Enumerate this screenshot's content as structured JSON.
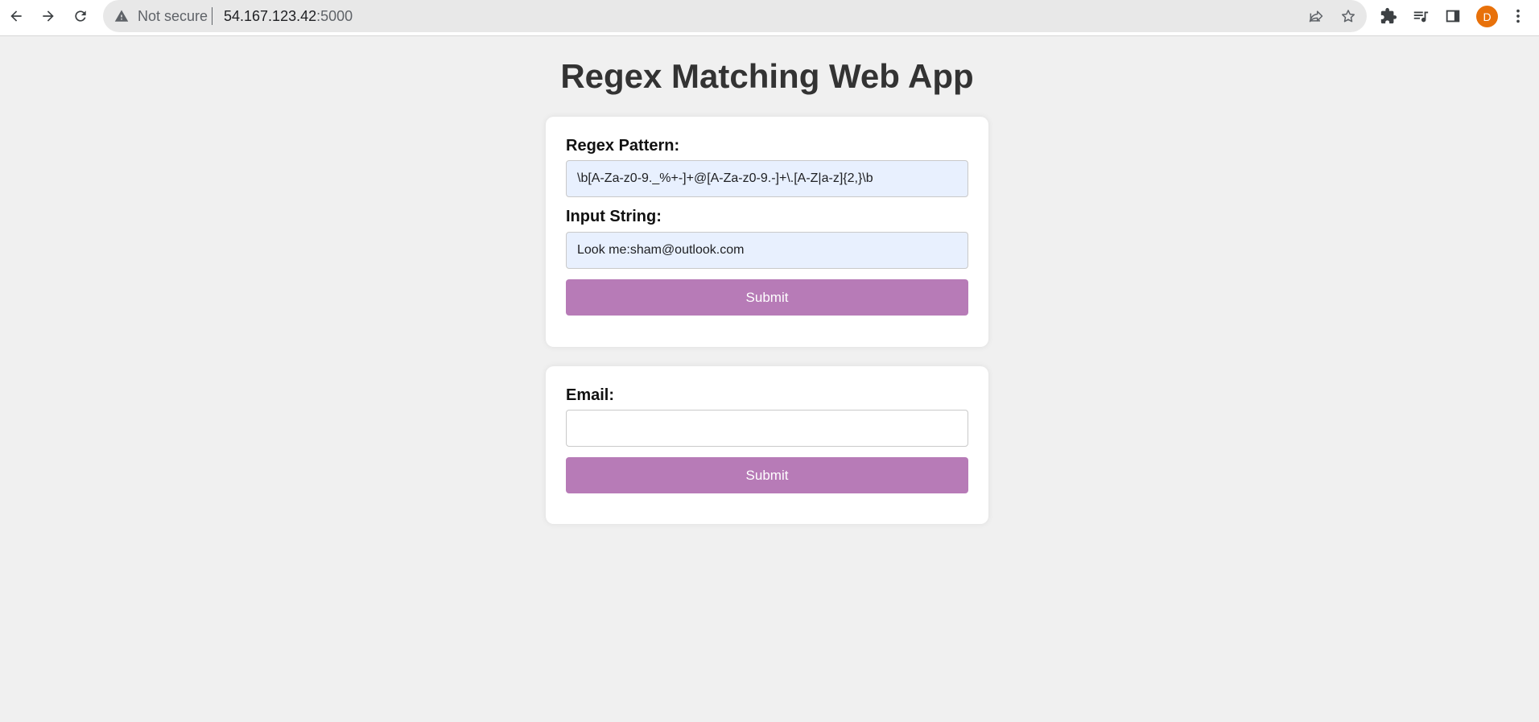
{
  "browser": {
    "security_text": "Not secure",
    "url_host": "54.167.123.42",
    "url_port": ":5000",
    "avatar_letter": "D",
    "avatar_color": "#e8710a"
  },
  "page": {
    "title": "Regex Matching Web App"
  },
  "regex_form": {
    "pattern_label": "Regex Pattern:",
    "pattern_value": "\\b[A-Za-z0-9._%+-]+@[A-Za-z0-9.-]+\\.[A-Z|a-z]{2,}\\b",
    "input_label": "Input String:",
    "input_value": "Look me:sham@outlook.com",
    "submit_label": "Submit"
  },
  "email_form": {
    "email_label": "Email:",
    "email_value": "",
    "submit_label": "Submit"
  },
  "colors": {
    "accent": "#b77bb7",
    "background": "#f0f0f0",
    "autofill": "#e8f0fe"
  }
}
